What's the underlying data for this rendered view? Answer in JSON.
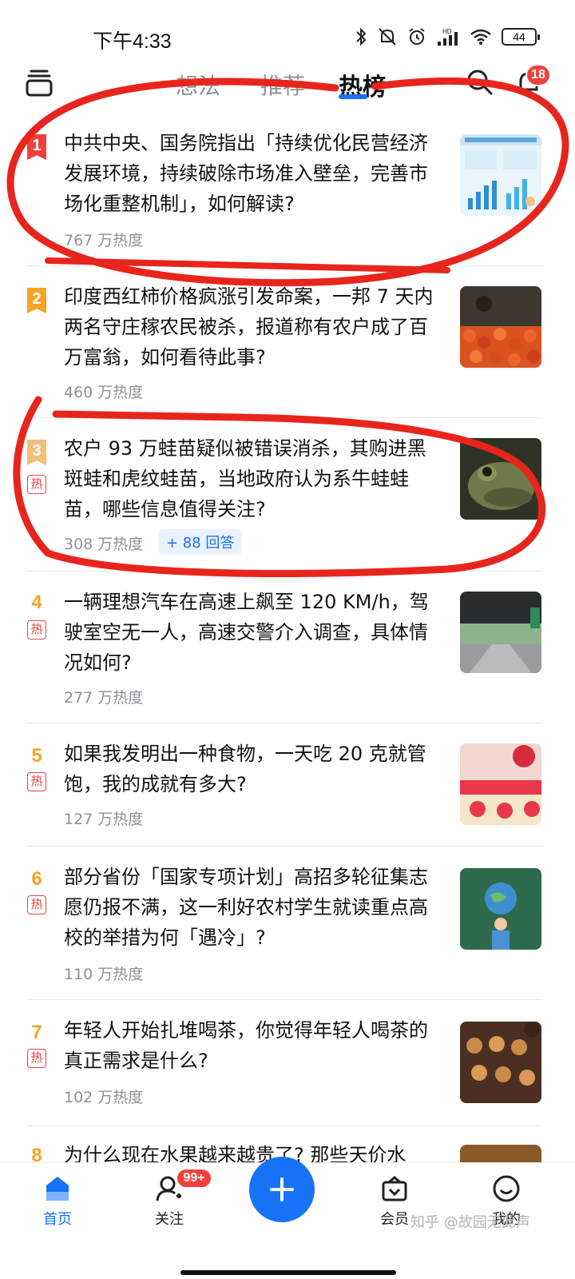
{
  "status_bar": {
    "time": "下午4:33",
    "battery": "44",
    "signal_label": "HD"
  },
  "top_nav": {
    "tabs": [
      {
        "label": "想法"
      },
      {
        "label": "推荐"
      },
      {
        "label": "热榜"
      }
    ],
    "active_tab": "热榜",
    "notification_count": "18",
    "icons": [
      "drawer-icon",
      "search-icon",
      "bell-icon"
    ]
  },
  "hot_list": [
    {
      "rank": "1",
      "title": "中共中央、国务院指出「持续优化民营经济发展环境，持续破除市场准入壁垒，完善市场化重整机制」，如何解读?",
      "heat": "767 万热度",
      "hot_tag": "",
      "answers": "",
      "thumb": "economy-chart-image"
    },
    {
      "rank": "2",
      "title": "印度西红柿价格疯涨引发命案，一邦 7 天内两名守庄稼农民被杀，报道称有农户成了百万富翁，如何看待此事?",
      "heat": "460 万热度",
      "hot_tag": "",
      "answers": "",
      "thumb": "tomato-image"
    },
    {
      "rank": "3",
      "title": "农户 93 万蛙苗疑似被错误消杀，其购进黑斑蛙和虎纹蛙苗，当地政府认为系牛蛙蛙苗，哪些信息值得关注?",
      "heat": "308 万热度",
      "hot_tag": "热",
      "answers": "+ 88 回答",
      "thumb": "frog-image"
    },
    {
      "rank": "4",
      "title": "一辆理想汽车在高速上飙至 120 KM/h，驾驶室空无一人，高速交警介入调查，具体情况如何?",
      "heat": "277 万热度",
      "hot_tag": "热",
      "answers": "",
      "thumb": "highway-image"
    },
    {
      "rank": "5",
      "title": "如果我发明出一种食物，一天吃 20 克就管饱，我的成就有多大?",
      "heat": "127 万热度",
      "hot_tag": "热",
      "answers": "",
      "thumb": "cake-image"
    },
    {
      "rank": "6",
      "title": "部分省份「国家专项计划」高招多轮征集志愿仍报不满，这一利好农村学生就读重点高校的举措为何「遇冷」?",
      "heat": "110 万热度",
      "hot_tag": "热",
      "answers": "",
      "thumb": "student-globe-image"
    },
    {
      "rank": "7",
      "title": "年轻人开始扎堆喝茶，你觉得年轻人喝茶的真正需求是什么?",
      "heat": "102 万热度",
      "hot_tag": "热",
      "answers": "",
      "thumb": "tea-image"
    },
    {
      "rank": "8",
      "title": "为什么现在水果越来越贵了? 那些天价水",
      "heat": "",
      "hot_tag": "",
      "answers": "",
      "thumb": "fruit-image"
    }
  ],
  "bottom_nav": {
    "items": [
      {
        "label": "首页",
        "icon": "home-icon",
        "active": true
      },
      {
        "label": "关注",
        "icon": "follow-icon",
        "badge": "99+"
      },
      {
        "label": "",
        "icon": "plus-icon"
      },
      {
        "label": "会员",
        "icon": "member-icon"
      },
      {
        "label": "我的",
        "icon": "profile-icon"
      }
    ],
    "watermark": "知乎 @故园无此声"
  },
  "colors": {
    "accent": "#1772f6",
    "red": "#f1403c",
    "rank_gold": "#f7a326",
    "text_secondary": "#8d9199",
    "annotation": "#e8251c"
  }
}
